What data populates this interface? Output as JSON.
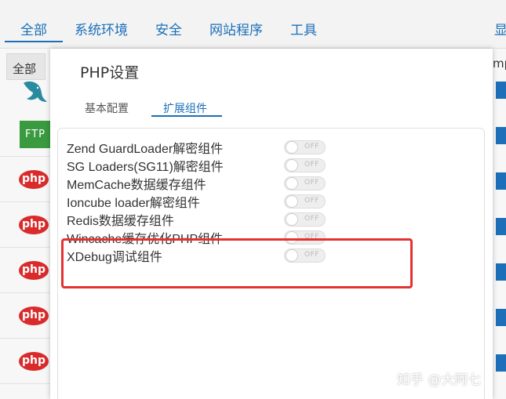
{
  "topnav": {
    "items": [
      {
        "label": "全部"
      },
      {
        "label": "系统环境"
      },
      {
        "label": "安全"
      },
      {
        "label": "网站程序"
      },
      {
        "label": "工具"
      },
      {
        "label": "显"
      }
    ]
  },
  "table": {
    "left_header": "全部",
    "right_header": "mp",
    "ftp_label": "FTP",
    "php_label": "php"
  },
  "modal": {
    "title": "PHP设置",
    "tabs": [
      {
        "label": "基本配置",
        "active": false
      },
      {
        "label": "扩展组件",
        "active": true
      }
    ],
    "extensions": [
      {
        "label": "Zend GuardLoader解密组件",
        "state": "OFF"
      },
      {
        "label": "SG Loaders(SG11)解密组件",
        "state": "OFF"
      },
      {
        "label": "MemCache数据缓存组件",
        "state": "OFF"
      },
      {
        "label": "Ioncube loader解密组件",
        "state": "OFF"
      },
      {
        "label": "Redis数据缓存组件",
        "state": "OFF"
      },
      {
        "label": "Wincache缓存优化PHP组件",
        "state": "OFF"
      },
      {
        "label": "XDebug调试组件",
        "state": "OFF"
      }
    ]
  },
  "watermark": "知乎 @大阿七",
  "colors": {
    "accent": "#1c6fb8",
    "highlight": "#e53131",
    "php_logo": "#d92b2b",
    "ftp_logo": "#3a9a40"
  }
}
